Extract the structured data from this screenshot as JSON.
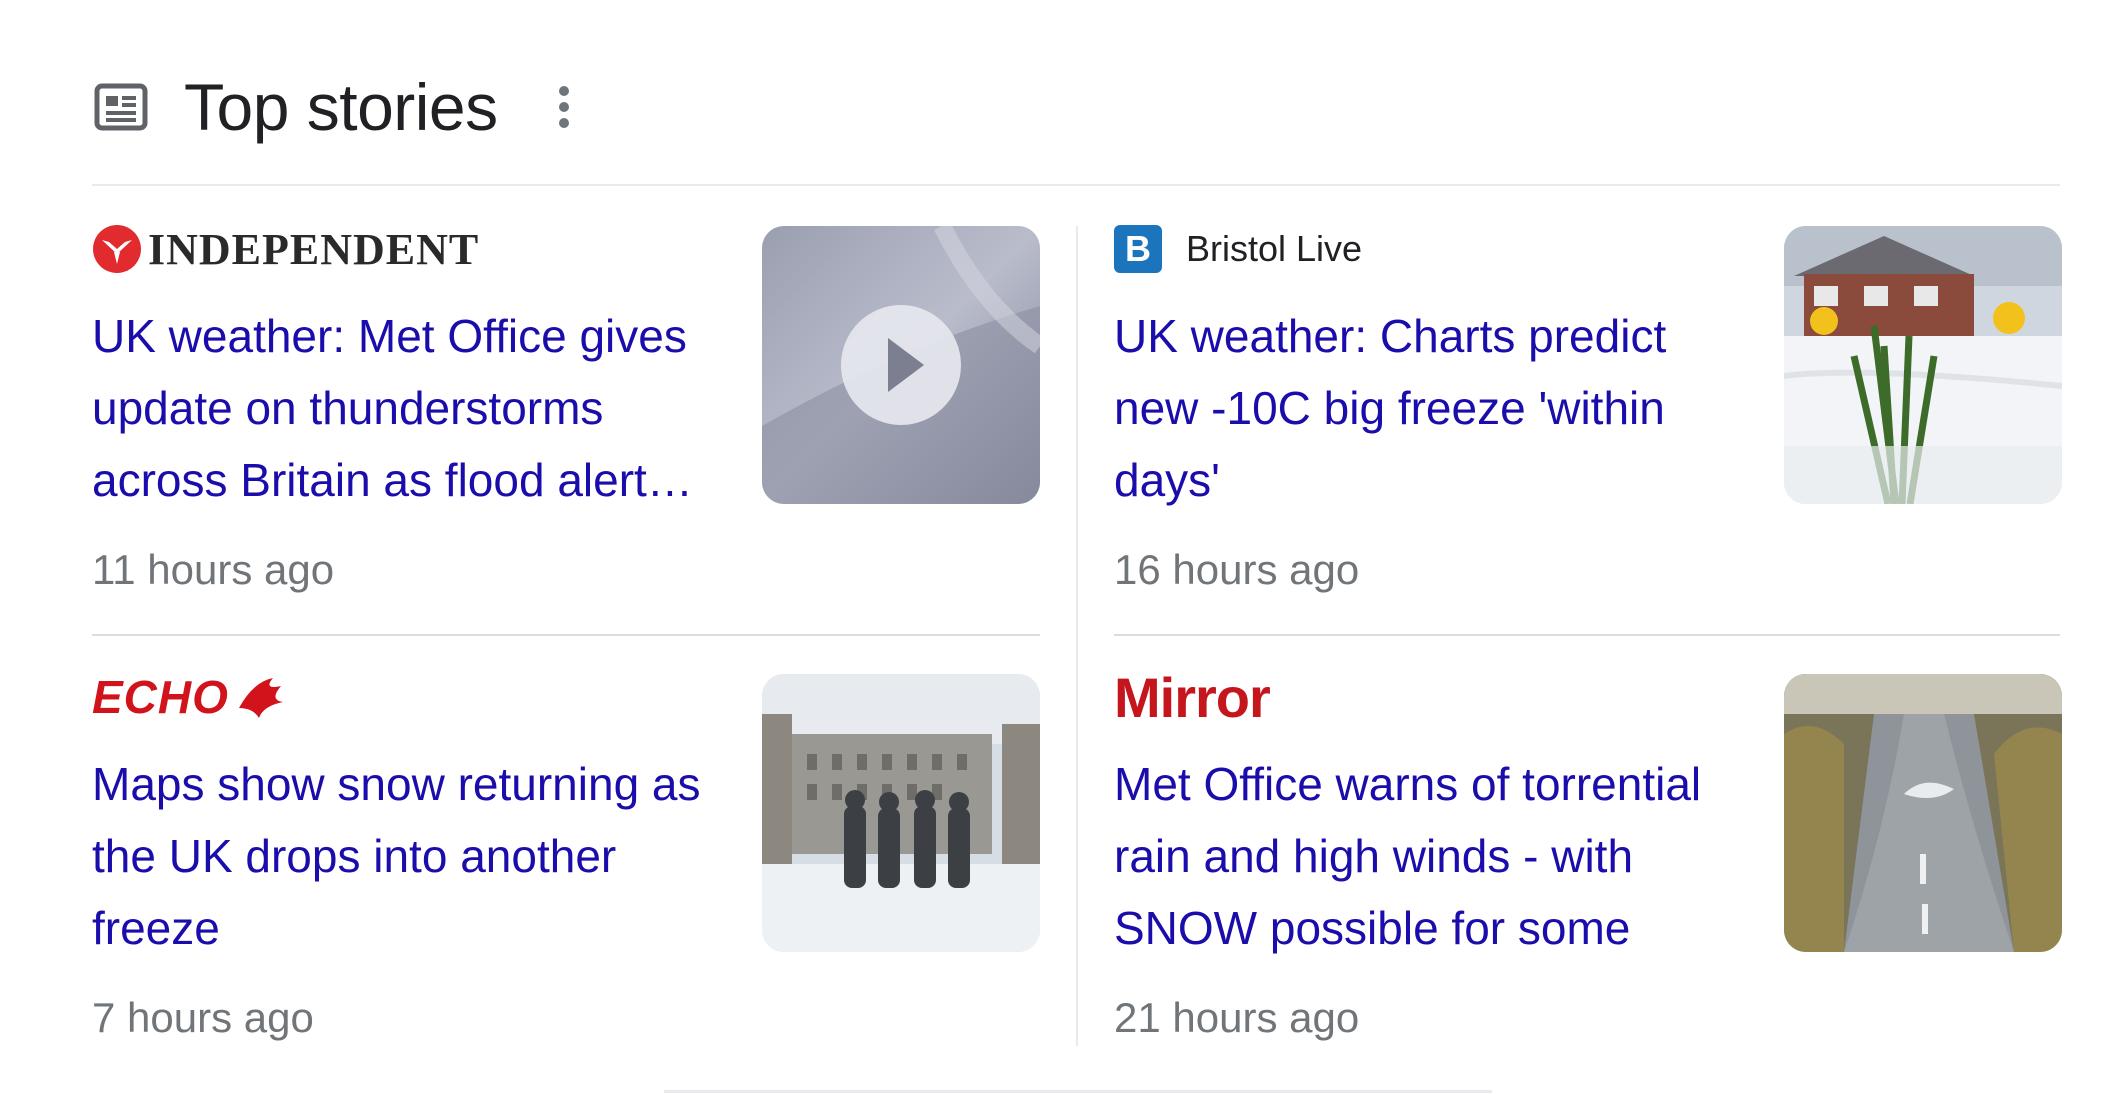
{
  "header": {
    "title": "Top stories",
    "icon": "news-icon",
    "menu_icon": "more-vert-icon"
  },
  "stories": [
    {
      "source": "INDEPENDENT",
      "headline": "UK weather: Met Office gives update on thunderstorms across Britain as flood alert issued",
      "time": "11 hours ago",
      "thumbnail": "video-thumbnail-storm",
      "has_video": true
    },
    {
      "source": "Bristol Live",
      "source_badge": "B",
      "headline": "UK weather: Charts predict new -10C big freeze 'within days'",
      "time": "16 hours ago",
      "thumbnail": "daffodils-in-snow"
    },
    {
      "source": "ECHO",
      "headline": "Maps show snow returning as the UK drops into another freeze",
      "time": "7 hours ago",
      "thumbnail": "beatles-statue-snow"
    },
    {
      "source": "Mirror",
      "headline": "Met Office warns of torrential rain and high winds - with SNOW possible for some",
      "time": "21 hours ago",
      "thumbnail": "flooded-road"
    }
  ],
  "colors": {
    "headline": "#1a0dab",
    "meta": "#70757a",
    "independent_red": "#e12b2f",
    "echo_red": "#d1141c",
    "mirror_red": "#c4161c",
    "bristol_blue": "#1c75bc"
  }
}
